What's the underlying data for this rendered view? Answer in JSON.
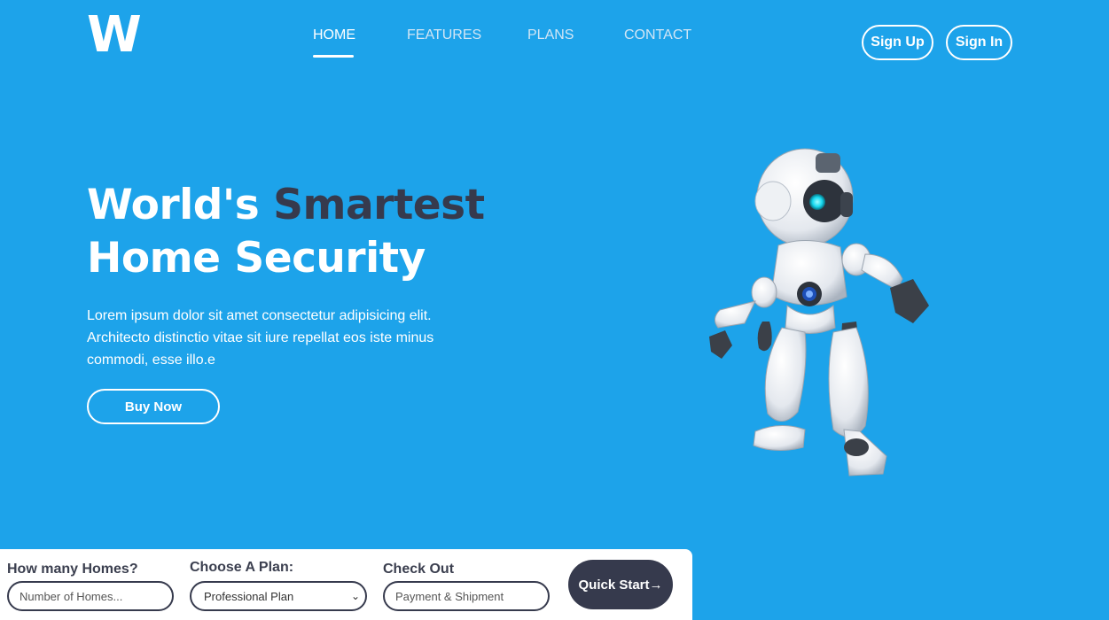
{
  "brand": {
    "logo": "W"
  },
  "nav": {
    "items": [
      {
        "label": "HOME"
      },
      {
        "label": "FEATURES"
      },
      {
        "label": "PLANS"
      },
      {
        "label": "CONTACT"
      }
    ]
  },
  "auth": {
    "signup": "Sign Up",
    "signin": "Sign In"
  },
  "hero": {
    "title_part1": "World's ",
    "title_accent": "Smartest",
    "title_line2": "Home Security",
    "description": "Lorem ipsum dolor sit amet consectetur adipisicing elit. Architecto distinctio vitae sit iure repellat eos iste minus commodi, esse illo.e",
    "buy_label": "Buy Now"
  },
  "quick_start": {
    "homes_label": "How many Homes?",
    "homes_placeholder": "Number of Homes...",
    "plan_label": "Choose A Plan:",
    "plan_selected": "Professional Plan",
    "checkout_label": "Check Out",
    "checkout_placeholder": "Payment & Shipment",
    "button_label": "Quick Start→"
  },
  "colors": {
    "background": "#1da3ea",
    "accent": "#363a4d",
    "white": "#ffffff"
  }
}
